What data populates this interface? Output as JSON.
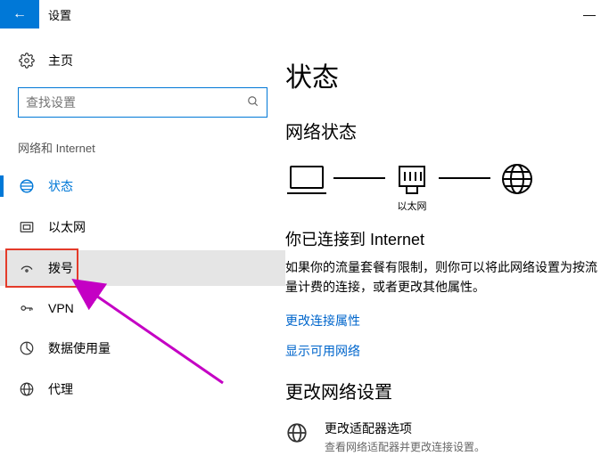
{
  "titlebar": {
    "back": "←",
    "title": "设置",
    "minimize": "—"
  },
  "sidebar": {
    "home": "主页",
    "search_placeholder": "查找设置",
    "section": "网络和 Internet",
    "items": [
      {
        "label": "状态"
      },
      {
        "label": "以太网"
      },
      {
        "label": "拨号"
      },
      {
        "label": "VPN"
      },
      {
        "label": "数据使用量"
      },
      {
        "label": "代理"
      }
    ]
  },
  "main": {
    "heading": "状态",
    "net_status_h": "网络状态",
    "diagram": {
      "ethernet": "以太网"
    },
    "connected_title": "你已连接到 Internet",
    "connected_desc": "如果你的流量套餐有限制，则你可以将此网络设置为按流量计费的连接，或者更改其他属性。",
    "link_props": "更改连接属性",
    "link_networks": "显示可用网络",
    "change_h": "更改网络设置",
    "adapter_title": "更改适配器选项",
    "adapter_sub": "查看网络适配器并更改连接设置。"
  }
}
